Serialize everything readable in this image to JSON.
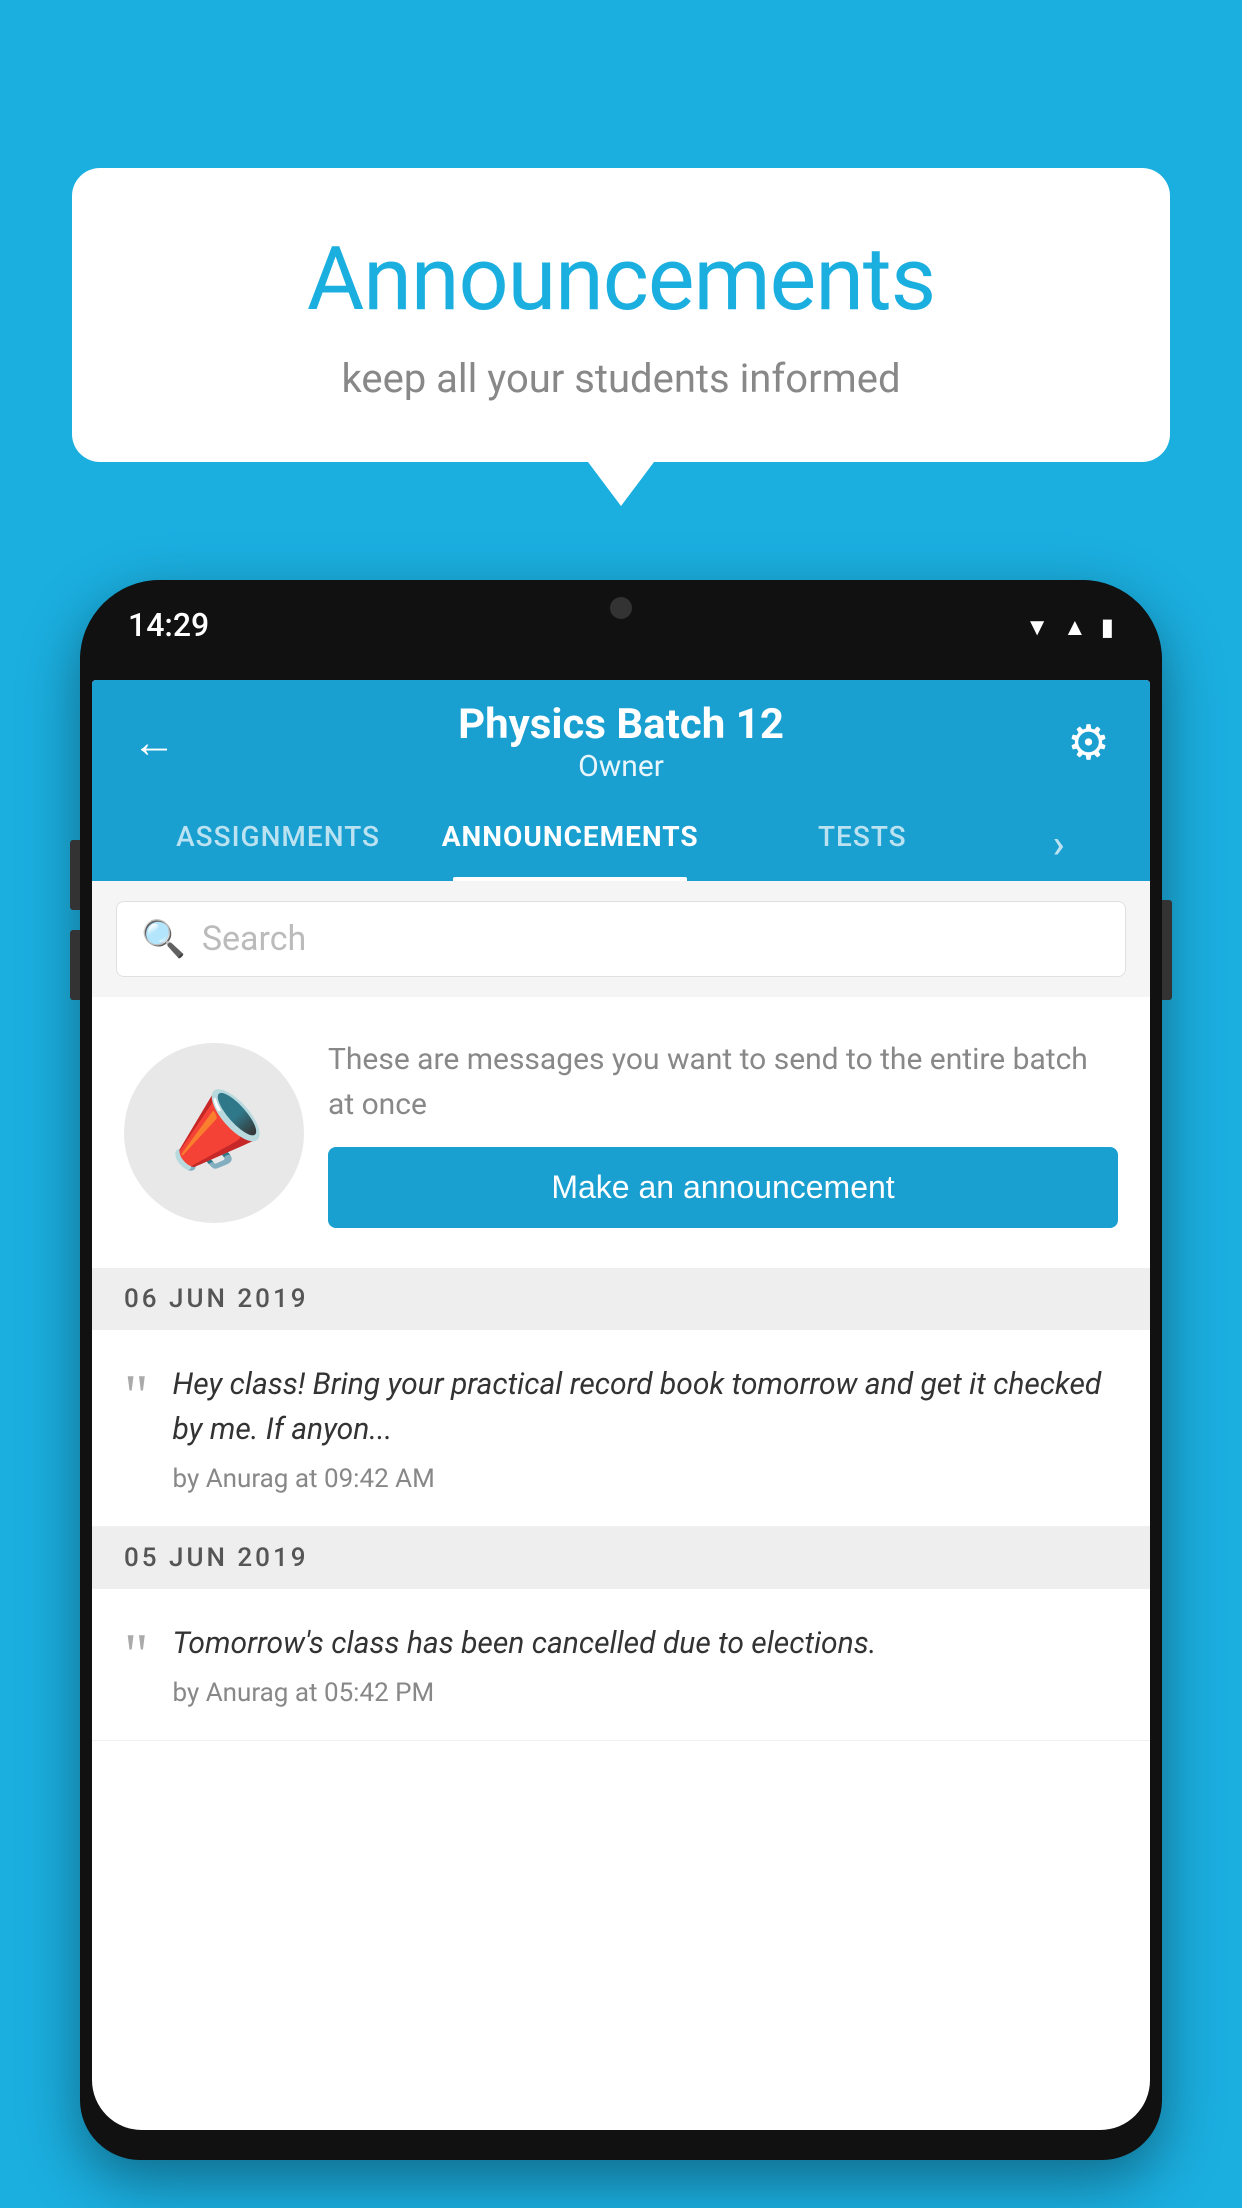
{
  "background_color": "#1BAFE0",
  "speech_bubble": {
    "title": "Announcements",
    "subtitle": "keep all your students informed"
  },
  "phone": {
    "status_bar": {
      "time": "14:29",
      "icons": [
        "wifi",
        "signal",
        "battery"
      ]
    },
    "header": {
      "back_label": "←",
      "batch_name": "Physics Batch 12",
      "role": "Owner",
      "gear_label": "⚙"
    },
    "tabs": [
      {
        "label": "ASSIGNMENTS",
        "active": false
      },
      {
        "label": "ANNOUNCEMENTS",
        "active": true
      },
      {
        "label": "TESTS",
        "active": false
      },
      {
        "label": "›",
        "active": false
      }
    ],
    "search": {
      "placeholder": "Search"
    },
    "promo": {
      "description_text": "These are messages you want to send to the entire batch at once",
      "button_label": "Make an announcement"
    },
    "announcements": [
      {
        "date": "06  JUN  2019",
        "messages": [
          {
            "text": "Hey class! Bring your practical record book tomorrow and get it checked by me. If anyon...",
            "author": "by Anurag at 09:42 AM"
          }
        ]
      },
      {
        "date": "05  JUN  2019",
        "messages": [
          {
            "text": "Tomorrow's class has been cancelled due to elections.",
            "author": "by Anurag at 05:42 PM"
          }
        ]
      }
    ]
  }
}
